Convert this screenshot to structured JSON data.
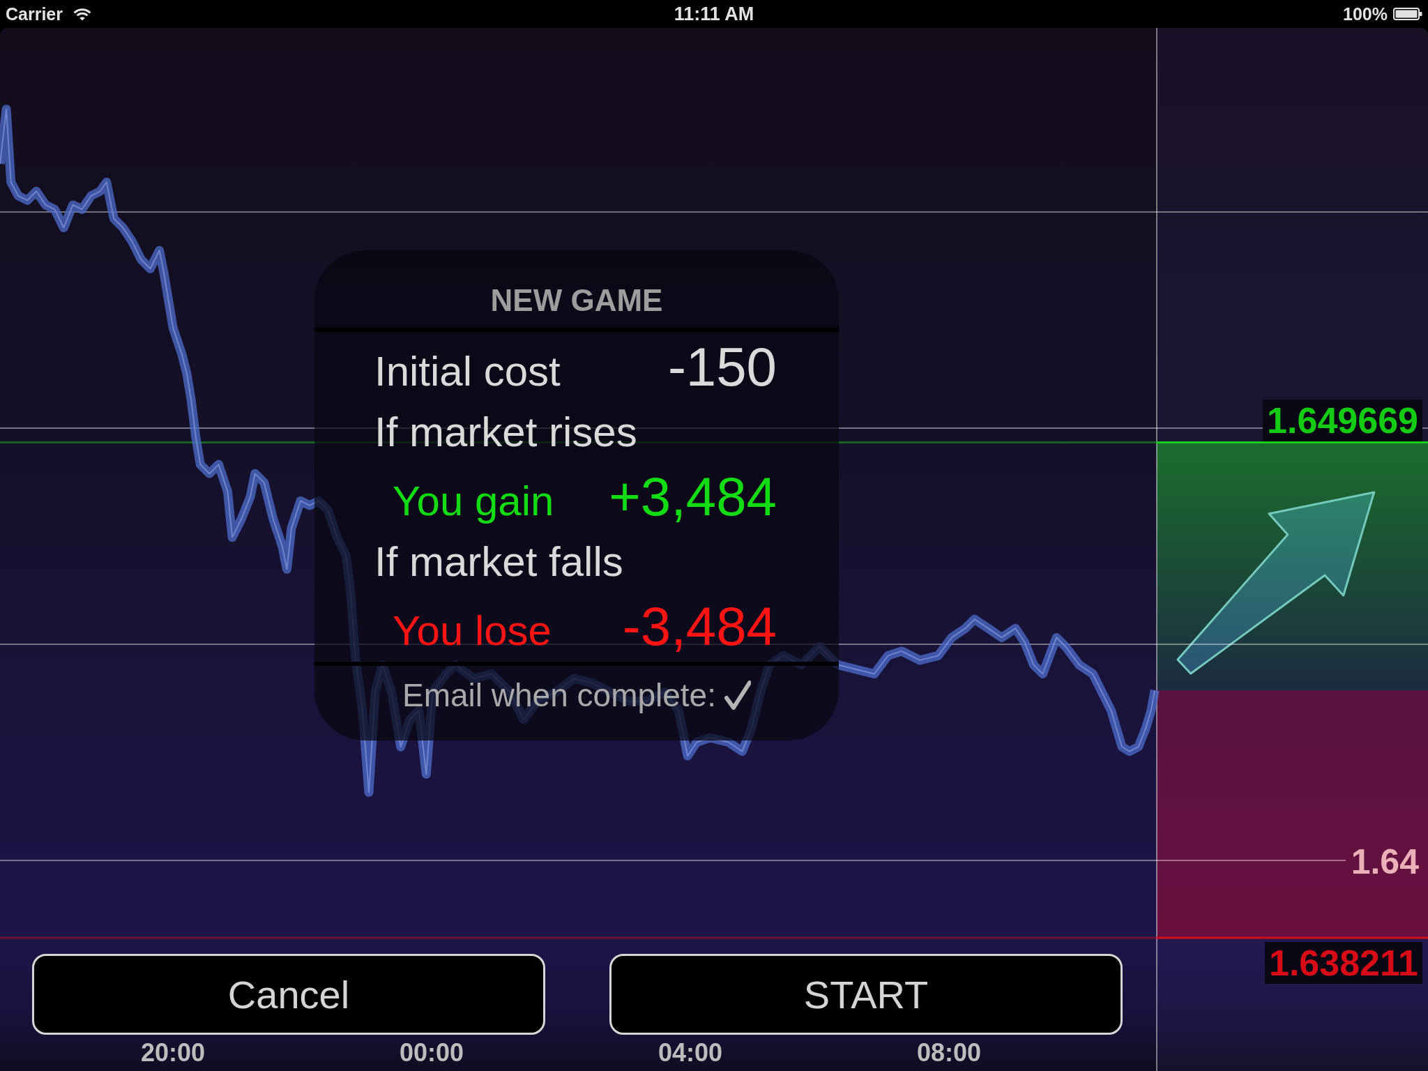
{
  "status_bar": {
    "carrier": "Carrier",
    "time": "11:11 AM",
    "battery": "100%"
  },
  "chart": {
    "price_scale_label": "1.64",
    "barriers": [
      {
        "kind": "upper",
        "label": "1.649669"
      },
      {
        "kind": "lower",
        "label": "1.638211"
      }
    ],
    "time_labels": [
      "20:00",
      "00:00",
      "04:00",
      "08:00"
    ]
  },
  "dialog": {
    "title": "NEW GAME",
    "rows": [
      {
        "kind": "cost",
        "label": "Initial cost",
        "value": "-150"
      },
      {
        "kind": "heading",
        "label": "If market rises"
      },
      {
        "kind": "gain",
        "label": "You gain",
        "value": "+3,484"
      },
      {
        "kind": "heading",
        "label": "If market falls"
      },
      {
        "kind": "loss",
        "label": "You lose",
        "value": "-3,484"
      }
    ],
    "email": {
      "label": "Email when complete:",
      "checked": true
    }
  },
  "buttons": [
    {
      "label": "Cancel"
    },
    {
      "label": "START"
    }
  ]
}
